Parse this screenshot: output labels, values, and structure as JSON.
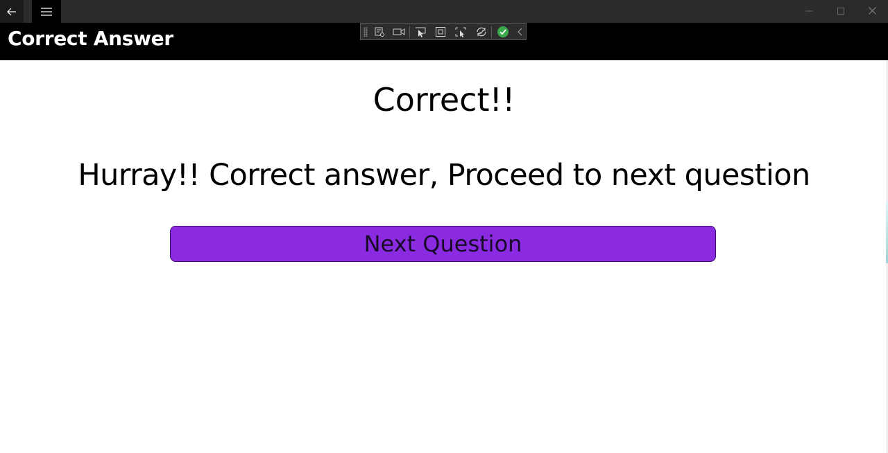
{
  "window": {
    "back_icon": "back-arrow-icon",
    "menu_icon": "hamburger-menu-icon",
    "caption_buttons": [
      "minimize-icon",
      "maximize-icon",
      "close-icon"
    ]
  },
  "header": {
    "title": "Correct Answer"
  },
  "debug_toolbar": {
    "icons": [
      "live-visual-tree-icon",
      "record-icon",
      "select-element-icon",
      "display-layout-adorners-icon",
      "track-focus-icon",
      "hot-reload-icon",
      "binding-failures-ok-icon",
      "collapse-chevron-icon"
    ],
    "status_color": "#3aa84a"
  },
  "content": {
    "heading": "Correct!!",
    "message": "Hurray!! Correct answer, Proceed to next question",
    "next_button_label": "Next Question",
    "button_color": "#8a2be2"
  }
}
